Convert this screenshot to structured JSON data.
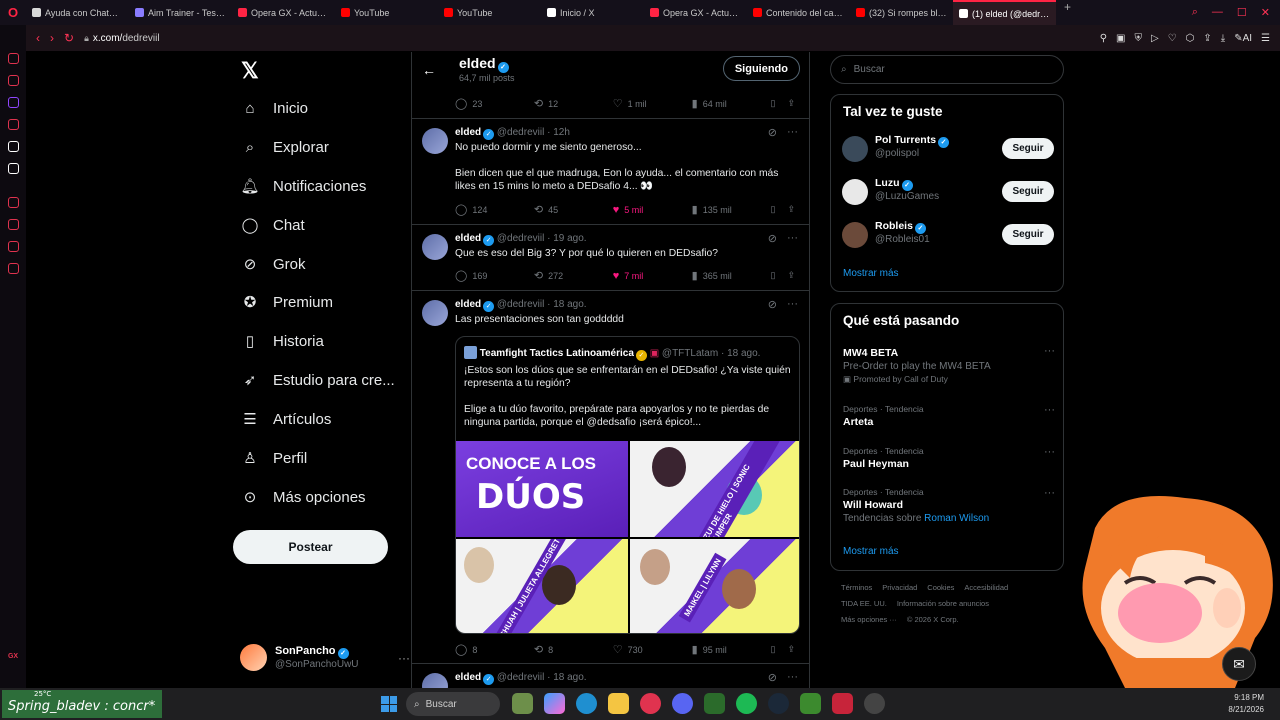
{
  "browser": {
    "tabs": [
      {
        "label": "Ayuda con ChatGPT",
        "color": "#d9d9d9"
      },
      {
        "label": "Aim Trainer - Test de",
        "color": "#8a7cff"
      },
      {
        "label": "Opera GX - Actualiza",
        "color": "#ff2444"
      },
      {
        "label": "YouTube",
        "color": "#ff0000"
      },
      {
        "label": "YouTube",
        "color": "#ff0000"
      },
      {
        "label": "Inicio / X",
        "color": "#ffffff"
      },
      {
        "label": "Opera GX - Actualiza",
        "color": "#ff2444"
      },
      {
        "label": "Contenido del canal -",
        "color": "#ff0000"
      },
      {
        "label": "(32) Si rompes bloque",
        "color": "#ff0000"
      },
      {
        "label": "(1) elded (@dedreviil) / X",
        "color": "#ffffff",
        "active": true
      }
    ],
    "url_host": "x.com/",
    "url_path": "dedreviil"
  },
  "nav": {
    "items": [
      {
        "label": "Inicio",
        "icon": "home-icon",
        "glyph": "⌂"
      },
      {
        "label": "Explorar",
        "icon": "search-icon",
        "glyph": "⌕"
      },
      {
        "label": "Notificaciones",
        "icon": "bell-icon",
        "glyph": "🔔︎",
        "badge": "1"
      },
      {
        "label": "Chat",
        "icon": "chat-icon",
        "glyph": "◯"
      },
      {
        "label": "Grok",
        "icon": "grok-icon",
        "glyph": "⊘"
      },
      {
        "label": "Premium",
        "icon": "premium-icon",
        "glyph": "✪"
      },
      {
        "label": "Historia",
        "icon": "bookmark-icon",
        "glyph": "▯"
      },
      {
        "label": "Estudio para cre...",
        "icon": "rocket-icon",
        "glyph": "➶"
      },
      {
        "label": "Artículos",
        "icon": "articles-icon",
        "glyph": "☰"
      },
      {
        "label": "Perfil",
        "icon": "profile-icon",
        "glyph": "♙"
      },
      {
        "label": "Más opciones",
        "icon": "more-icon",
        "glyph": "⊙"
      }
    ],
    "post_label": "Postear",
    "account": {
      "name": "SonPancho",
      "handle": "@SonPanchoUwU"
    }
  },
  "profile_header": {
    "name": "elded",
    "posts": "64,7 mil posts",
    "following_label": "Siguiendo"
  },
  "tweets": [
    {
      "stats": {
        "replies": "23",
        "retweets": "12",
        "likes": "1 mil",
        "views": "64 mil"
      }
    },
    {
      "name": "elded",
      "handle": "@dedreviil",
      "time": "· 12h",
      "lines": [
        "No puedo dormir y me siento generoso...",
        "",
        "Bien dicen que el que madruga, Eon lo ayuda... el comentario con más likes en 15 mins lo meto a DEDsafio 4... 👀"
      ],
      "stats": {
        "replies": "124",
        "retweets": "45",
        "likes": "5 mil",
        "views": "135 mil"
      },
      "liked": true
    },
    {
      "name": "elded",
      "handle": "@dedreviil",
      "time": "· 19 ago.",
      "lines": [
        "Que es eso del Big 3? Y por qué lo quieren en DEDsafio?"
      ],
      "stats": {
        "replies": "169",
        "retweets": "272",
        "likes": "7 mil",
        "views": "365 mil"
      },
      "liked": true
    },
    {
      "name": "elded",
      "handle": "@dedreviil",
      "time": "· 18 ago.",
      "lines": [
        "Las presentaciones son tan goddddd"
      ],
      "quote": {
        "name": "Teamfight Tactics Latinoamérica",
        "handle": "@TFTLatam",
        "time": "· 18 ago.",
        "text1": "¡Estos son los dúos que se enfrentarán en el DEDsafio! ¿Ya viste quién representa a tu región?",
        "text2": "Elige a tu dúo favorito, prepárate para apoyarlos y no te pierdas de ninguna partida, porque el @dedsafio ¡será épico!...",
        "media_text1": "CONOCE A LOS",
        "media_text2": "DÚOS",
        "tags": [
          "ZUI DE HIELO | SONIC JUMPER",
          "JOSHUAH | JULIETA ALLEGRETTI",
          "MAIKEL | LILYNN"
        ]
      },
      "stats": {
        "replies": "8",
        "retweets": "8",
        "likes": "730",
        "views": "95 mil"
      }
    },
    {
      "name": "elded",
      "handle": "@dedreviil",
      "time": "· 18 ago."
    }
  ],
  "right": {
    "search_placeholder": "Buscar",
    "suggest_title": "Tal vez te guste",
    "suggestions": [
      {
        "name": "Pol Turrents",
        "handle": "@polispol",
        "button": "Seguir",
        "color": "#3a4a5a"
      },
      {
        "name": "Luzu",
        "handle": "@LuzuGames",
        "button": "Seguir",
        "color": "#e8e8e8"
      },
      {
        "name": "Robleis",
        "handle": "@Robleis01",
        "button": "Seguir",
        "color": "#6b4a3a"
      }
    ],
    "show_more": "Mostrar más",
    "trends_title": "Qué está pasando",
    "trends": [
      {
        "category": "",
        "name": "MW4 BETA",
        "extra": "Pre-Order to play the MW4 BETA",
        "extra2": "Promoted by Call of Duty"
      },
      {
        "category": "Deportes · Tendencia",
        "name": "Arteta",
        "extra": ""
      },
      {
        "category": "Deportes · Tendencia",
        "name": "Paul Heyman",
        "extra": ""
      },
      {
        "category": "Deportes · Tendencia",
        "name": "Will Howard",
        "extra": "Tendencias sobre",
        "link": "Roman Wilson"
      }
    ],
    "trends_more": "Mostrar más",
    "footer": [
      "Términos",
      "Privacidad",
      "Cookies",
      "Accesibilidad",
      "TIDA EE. UU.",
      "Información sobre anuncios",
      "Más opciones ···",
      "© 2026 X Corp."
    ]
  },
  "taskbar": {
    "weather_temp": "25°C",
    "overlay_text": "Spring_bladev : concr*",
    "search_label": "Buscar",
    "time": "9:18 PM",
    "date": "8/21/2026"
  }
}
